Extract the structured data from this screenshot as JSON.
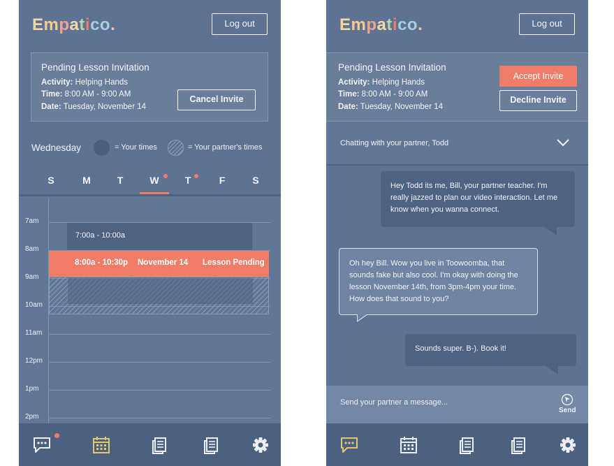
{
  "logo": {
    "letters": [
      {
        "ch": "E",
        "color": "#f3d8a5"
      },
      {
        "ch": "m",
        "color": "#f4ce86"
      },
      {
        "ch": "p",
        "color": "#f0a58b"
      },
      {
        "ch": "a",
        "color": "#f3d8a5"
      },
      {
        "ch": "t",
        "color": "#b6d6a8"
      },
      {
        "ch": "i",
        "color": "#f07d67"
      },
      {
        "ch": "c",
        "color": "#a6cfe0"
      },
      {
        "ch": "o",
        "color": "#a6cfe0"
      },
      {
        "ch": ".",
        "color": "#f4ce86"
      }
    ]
  },
  "header": {
    "logout_label": "Log out"
  },
  "invitation": {
    "title": "Pending Lesson Invitation",
    "activity_label": "Activity:",
    "activity_value": "Helping Hands",
    "time_label": "Time:",
    "time_value": "8:00 AM - 9:00 AM",
    "date_label": "Date:",
    "date_value": "Tuesday, November 14",
    "cancel_label": "Cancel Invite",
    "accept_label": "Accept Invite",
    "decline_label": "Decline Invite"
  },
  "legend": {
    "day": "Wednesday",
    "your_times": "= Your times",
    "partner_times": "= Your partner's times"
  },
  "weekdays": [
    {
      "label": "S",
      "dot": false
    },
    {
      "label": "M",
      "dot": false
    },
    {
      "label": "T",
      "dot": false
    },
    {
      "label": "W",
      "dot": true,
      "selected": true
    },
    {
      "label": "T",
      "dot": true
    },
    {
      "label": "F",
      "dot": false
    },
    {
      "label": "S",
      "dot": false
    }
  ],
  "calendar": {
    "hours": [
      "7am",
      "8am",
      "9am",
      "10am",
      "11am",
      "12pm",
      "1pm",
      "2pm"
    ],
    "availability_label": "7:00a - 10:00a",
    "lesson": {
      "time": "8:00a - 10:30p",
      "date": "November 14",
      "status": "Lesson Pending"
    }
  },
  "nav": {
    "items": [
      "chat-icon",
      "calendar-icon",
      "document-icon",
      "notes-icon",
      "gear-icon"
    ]
  },
  "chat": {
    "header": "Chatting with your partner, Todd",
    "messages": [
      {
        "from": "me",
        "text": "Hey Todd its me, Bill, your partner teacher. I'm really jazzed to plan our video interaction. Let me know when you wanna connect."
      },
      {
        "from": "partner",
        "text": "Oh hey Bill. Wow you live in Toowoomba, that sounds fake but also cool. I'm okay with doing the lesson November 14th, from 3pm-4pm your time. How does that sound to you?"
      },
      {
        "from": "me",
        "text": "Sounds super. B-). Book it!"
      }
    ],
    "composer_placeholder": "Send your partner a message...",
    "send_label": "Send"
  },
  "colors": {
    "background": "#5e7393",
    "accent": "#f07d67",
    "dark_block": "#4e6283",
    "nav_active": "#e3c86e"
  }
}
